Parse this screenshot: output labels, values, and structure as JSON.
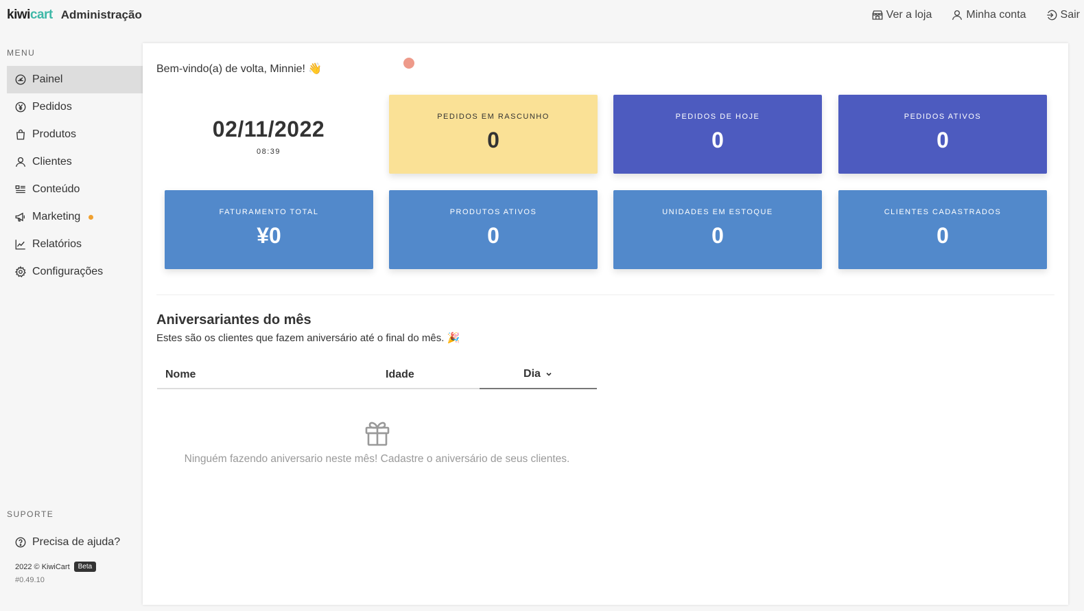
{
  "header": {
    "logo_kiwi": "kiwi",
    "logo_cart": "cart",
    "title": "Administração",
    "actions": [
      {
        "label": "Ver a loja",
        "icon": "store-icon"
      },
      {
        "label": "Minha conta",
        "icon": "user-icon"
      },
      {
        "label": "Sair",
        "icon": "logout-icon"
      }
    ]
  },
  "sidebar": {
    "menu_heading": "MENU",
    "items": [
      {
        "label": "Painel",
        "icon": "dashboard-icon",
        "active": true
      },
      {
        "label": "Pedidos",
        "icon": "yen-circle-icon"
      },
      {
        "label": "Produtos",
        "icon": "shopping-bag-icon"
      },
      {
        "label": "Clientes",
        "icon": "user-icon"
      },
      {
        "label": "Conteúdo",
        "icon": "content-icon"
      },
      {
        "label": "Marketing",
        "icon": "megaphone-icon",
        "badge_color": "#f0a030"
      },
      {
        "label": "Relatórios",
        "icon": "chart-icon"
      },
      {
        "label": "Configurações",
        "icon": "gear-icon"
      }
    ],
    "support_heading": "SUPORTE",
    "help_label": "Precisa de ajuda?",
    "footer_copyright": "2022 © KiwiCart",
    "footer_badge": "Beta",
    "footer_version": "#0.49.10"
  },
  "main": {
    "welcome": "Bem-vindo(a) de volta, Minnie! 👋",
    "date": "02/11/2022",
    "time": "08:39",
    "cards": [
      {
        "label": "PEDIDOS EM RASCUNHO",
        "value": "0",
        "color": "#fae196"
      },
      {
        "label": "PEDIDOS DE HOJE",
        "value": "0",
        "color": "#4d5bbf"
      },
      {
        "label": "PEDIDOS ATIVOS",
        "value": "0",
        "color": "#4d5bbf"
      },
      {
        "label": "FATURAMENTO TOTAL",
        "value": "¥0",
        "color": "#5289cb"
      },
      {
        "label": "PRODUTOS ATIVOS",
        "value": "0",
        "color": "#5289cb"
      },
      {
        "label": "UNIDADES EM ESTOQUE",
        "value": "0",
        "color": "#5289cb"
      },
      {
        "label": "CLIENTES CADASTRADOS",
        "value": "0",
        "color": "#5289cb"
      }
    ],
    "birthdays": {
      "title": "Aniversariantes do mês",
      "subtitle": "Estes são os clientes que fazem aniversário até o final do mês. 🎉",
      "columns": [
        "Nome",
        "Idade",
        "Dia"
      ],
      "empty_icon": "gift-icon",
      "empty_text": "Ninguém fazendo aniversario neste mês! Cadastre o aniversário de seus clientes."
    }
  }
}
